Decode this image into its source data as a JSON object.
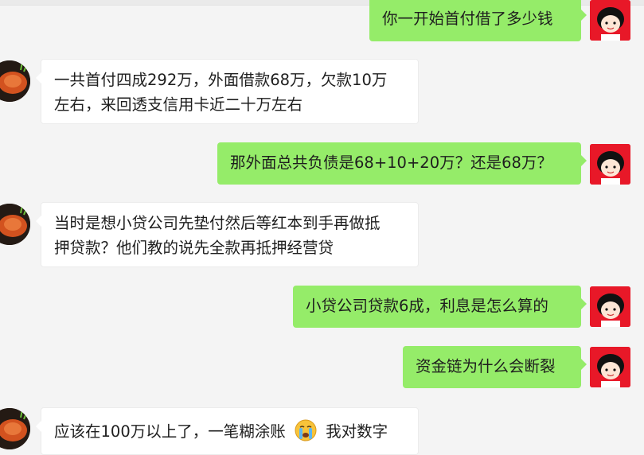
{
  "messages": [
    {
      "side": "out",
      "text": "你一开始首付借了多少钱"
    },
    {
      "side": "in",
      "lines": [
        "一共首付四成292万，外面借款68万，欠款10万",
        "左右，来回透支信用卡近二十万左右"
      ]
    },
    {
      "side": "out",
      "text": "那外面总共负债是68+10+20万？还是68万？"
    },
    {
      "side": "in",
      "lines": [
        "当时是想小贷公司先垫付然后等红本到手再做抵",
        "押贷款？他们教的说先全款再抵押经营贷"
      ]
    },
    {
      "side": "out",
      "text": "小贷公司贷款6成，利息是怎么算的"
    },
    {
      "side": "out",
      "text": "资金链为什么会断裂"
    },
    {
      "side": "in",
      "text_before": "应该在100万以上了，一笔糊涂账",
      "emoji": "crying-face-emoji",
      "text_after": "我对数字"
    }
  ],
  "colors": {
    "outgoing_bubble": "#95ec69",
    "incoming_bubble": "#ffffff",
    "background": "#f4f4f4"
  },
  "avatars": {
    "self": "cartoon-girl-avatar",
    "other": "crab-dish-avatar"
  }
}
